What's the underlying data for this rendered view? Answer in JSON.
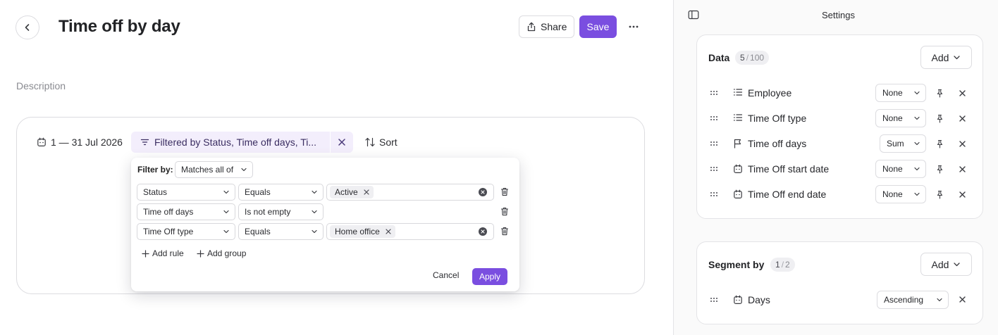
{
  "header": {
    "title": "Time off by day",
    "share_label": "Share",
    "save_label": "Save",
    "description_placeholder": "Description"
  },
  "toolbar": {
    "date_range": "1 — 31 Jul 2026",
    "filter_summary": "Filtered by Status, Time off days, Ti...",
    "sort_label": "Sort"
  },
  "filter_popover": {
    "filter_by_label": "Filter by:",
    "match_mode": "Matches all of",
    "rules": [
      {
        "field": "Status",
        "operator": "Equals",
        "value": "Active"
      },
      {
        "field": "Time off days",
        "operator": "Is not empty",
        "value": ""
      },
      {
        "field": "Time Off type",
        "operator": "Equals",
        "value": "Home office"
      }
    ],
    "add_rule_label": "Add rule",
    "add_group_label": "Add group",
    "cancel_label": "Cancel",
    "apply_label": "Apply"
  },
  "settings": {
    "title": "Settings",
    "data": {
      "title": "Data",
      "count": "5",
      "limit": "100",
      "add_label": "Add",
      "items": [
        {
          "label": "Employee",
          "icon": "list-icon",
          "aggregation": "None"
        },
        {
          "label": "Time Off type",
          "icon": "list-icon",
          "aggregation": "None"
        },
        {
          "label": "Time off days",
          "icon": "flag-icon",
          "aggregation": "Sum"
        },
        {
          "label": "Time Off start date",
          "icon": "calendar-icon",
          "aggregation": "None"
        },
        {
          "label": "Time Off end date",
          "icon": "calendar-icon",
          "aggregation": "None"
        }
      ]
    },
    "segment": {
      "title": "Segment by",
      "count": "1",
      "limit": "2",
      "add_label": "Add",
      "items": [
        {
          "label": "Days",
          "icon": "calendar-icon",
          "order": "Ascending"
        }
      ]
    }
  },
  "colors": {
    "accent": "#7a4ee0",
    "filter_chip_bg": "#f3eefc"
  }
}
